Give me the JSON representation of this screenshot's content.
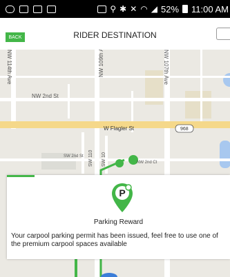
{
  "status_bar": {
    "battery": "52%",
    "time": "11:00 AM",
    "icons": [
      "message-icon",
      "image-icon",
      "image-icon",
      "image-icon",
      "cast-icon",
      "location-icon",
      "bluetooth-icon",
      "mute-icon",
      "wifi-icon",
      "signal-icon",
      "battery-icon"
    ]
  },
  "header": {
    "back_label": "BACK",
    "title": "RIDER DESTINATION",
    "right_icon": "chat-icon"
  },
  "map": {
    "streets": {
      "nw_114th": "NW 114th Ave",
      "nw_2nd": "NW 2nd St",
      "nw_109th": "NW 109th Ave",
      "nw_107th": "NW 107th Ave",
      "w_flagler": "W Flagler St",
      "route_968": "968",
      "sw_2nd": "SW 2nd St",
      "sw_110": "SW 110",
      "sw_10": "SW 10",
      "nw_2nd_ct": "NW 2nd Ct"
    },
    "colors": {
      "route": "#43b648",
      "road": "#ffffff",
      "highway": "#f5d88a",
      "water": "#a8c8ef"
    }
  },
  "dialog": {
    "title": "Parking Reward",
    "message": "Your carpool parking permit has been issued, feel free to use one of the premium carpool spaces available",
    "icon_letter": "P",
    "accent": "#43b648"
  }
}
